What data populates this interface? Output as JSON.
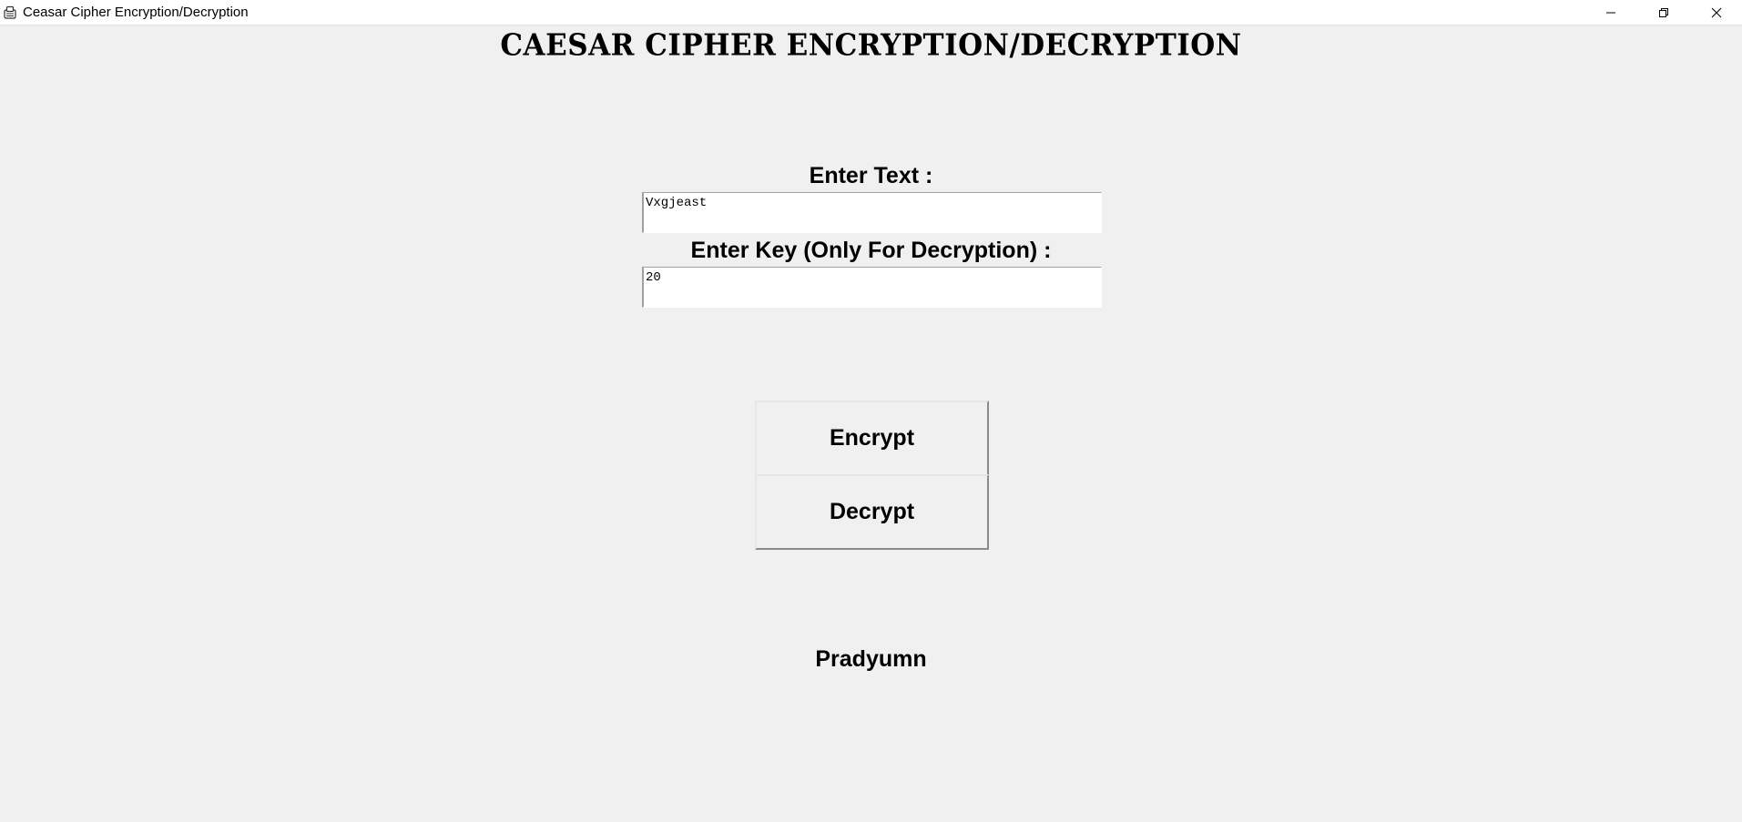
{
  "window": {
    "title": "Ceasar Cipher Encryption/Decryption",
    "controls": {
      "minimize": "minimize-icon",
      "maximize": "restore-icon",
      "close": "close-icon"
    }
  },
  "main": {
    "heading": "CAESAR CIPHER ENCRYPTION/DECRYPTION",
    "text_label": "Enter Text :",
    "text_value": "Vxgjeast",
    "key_label": "Enter Key (Only For Decryption) :",
    "key_value": "20",
    "encrypt_label": "Encrypt",
    "decrypt_label": "Decrypt",
    "author": "Pradyumn"
  },
  "colors": {
    "background": "#f0f0f0",
    "titlebar": "#ffffff",
    "text": "#000000"
  }
}
